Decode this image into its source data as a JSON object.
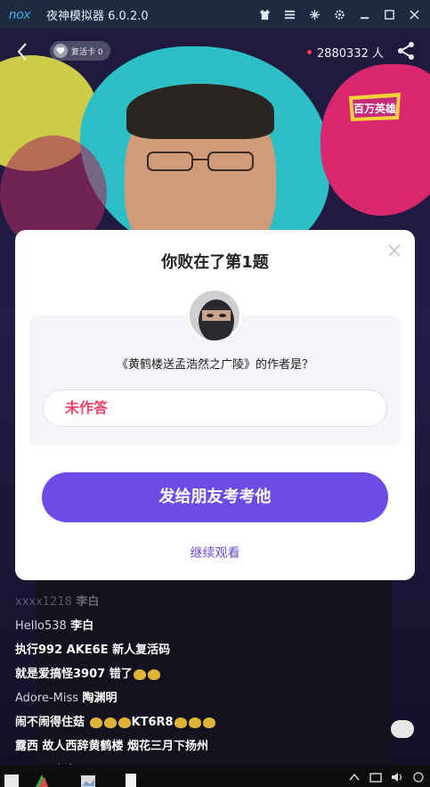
{
  "emulator": {
    "logo_text": "nox",
    "title": "夜神模拟器 6.0.2.0",
    "controls": [
      "shirt-icon",
      "menu-icon",
      "minimize-icon",
      "gear-icon",
      "restore-icon",
      "maximize-icon",
      "close-icon"
    ]
  },
  "live": {
    "revive_card": "复活卡 0",
    "viewers": "2880332 人",
    "brand_badge": "百万英雄"
  },
  "modal": {
    "title": "你败在了第1题",
    "question": "《黄鹤楼送孟浩然之广陵》的作者是？",
    "answer": "未作答",
    "share_button": "发给朋友考考他",
    "continue_link": "继续观看"
  },
  "chat": [
    {
      "nick": "xxxx1218",
      "text": "李白",
      "faded": true
    },
    {
      "nick": "Hello538",
      "text": "李白"
    },
    {
      "nick": "",
      "text": "执行992 AKE6E 新人复活码"
    },
    {
      "nick": "",
      "text": "就是爱搞怪3907 错了"
    },
    {
      "nick": "Adore-Miss",
      "text": "陶渊明"
    },
    {
      "nick": "",
      "text": "闹不闹得住菇",
      "suffix": "KT6R8"
    },
    {
      "nick": "",
      "text": "露西 故人西辞黄鹤楼 烟花三月下扬州"
    },
    {
      "nick": "qzusb",
      "text": "李白",
      "faded": true
    }
  ],
  "colors": {
    "accent_purple": "#6d4be6",
    "answer_red": "#f0456a",
    "titlebar": "#1d2a3f"
  }
}
